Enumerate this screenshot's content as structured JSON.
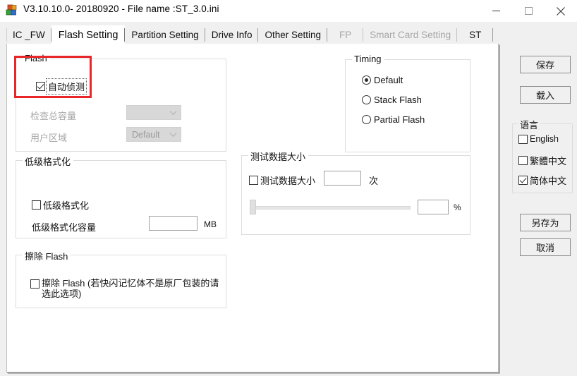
{
  "window": {
    "title": "V3.10.10.0- 20180920 - File name :ST_3.0.ini",
    "app_icon": "blocks-icon",
    "minimize": "—",
    "maximize": "□",
    "close": "✕"
  },
  "tabs": [
    {
      "label": "IC _FW",
      "active": false,
      "disabled": false
    },
    {
      "label": "Flash Setting",
      "active": true,
      "disabled": false
    },
    {
      "label": "Partition Setting",
      "active": false,
      "disabled": false
    },
    {
      "label": "Drive Info",
      "active": false,
      "disabled": false
    },
    {
      "label": "Other Setting",
      "active": false,
      "disabled": false
    },
    {
      "label": "FP",
      "active": false,
      "disabled": true
    },
    {
      "label": "Smart Card Setting",
      "active": false,
      "disabled": true
    },
    {
      "label": "ST",
      "active": false,
      "disabled": false
    }
  ],
  "flash_group": {
    "legend": "Flash",
    "auto_detect": {
      "label": "自动侦测",
      "checked": true,
      "focused": true
    },
    "check_capacity": {
      "label": "检查总容量",
      "value": "",
      "disabled": true
    },
    "user_area": {
      "label": "用户区域",
      "value": "Default",
      "disabled": true
    }
  },
  "timing_group": {
    "legend": "Timing",
    "options": [
      {
        "label": "Default",
        "selected": true
      },
      {
        "label": "Stack Flash",
        "selected": false
      },
      {
        "label": "Partial Flash",
        "selected": false
      }
    ]
  },
  "lowlevel_group": {
    "legend": "低级格式化",
    "checkbox": {
      "label": "低级格式化",
      "checked": false
    },
    "capacity_label": "低级格式化容量",
    "capacity_value": "",
    "capacity_unit": "MB"
  },
  "testdata_group": {
    "legend": "测试数据大小",
    "checkbox": {
      "label": "测试数据大小",
      "checked": false
    },
    "count_value": "",
    "count_unit": "次",
    "slider_percent": 0,
    "percent_value": "",
    "percent_unit": "%"
  },
  "erase_group": {
    "legend": "擦除 Flash",
    "checkbox": {
      "label": "擦除 Flash (若快闪记忆体不是原厂包装的请选此选项)",
      "checked": false
    }
  },
  "sidebar": {
    "save_label": "保存",
    "load_label": "载入",
    "language": {
      "legend": "语言",
      "options": [
        {
          "label": "English",
          "checked": false
        },
        {
          "label": "繁體中文",
          "checked": false
        },
        {
          "label": "简体中文",
          "checked": true
        }
      ]
    },
    "saveas_label": "另存为",
    "cancel_label": "取消"
  },
  "annotation": {
    "highlight_color": "#e8262a",
    "target": "auto-detect-checkbox"
  }
}
